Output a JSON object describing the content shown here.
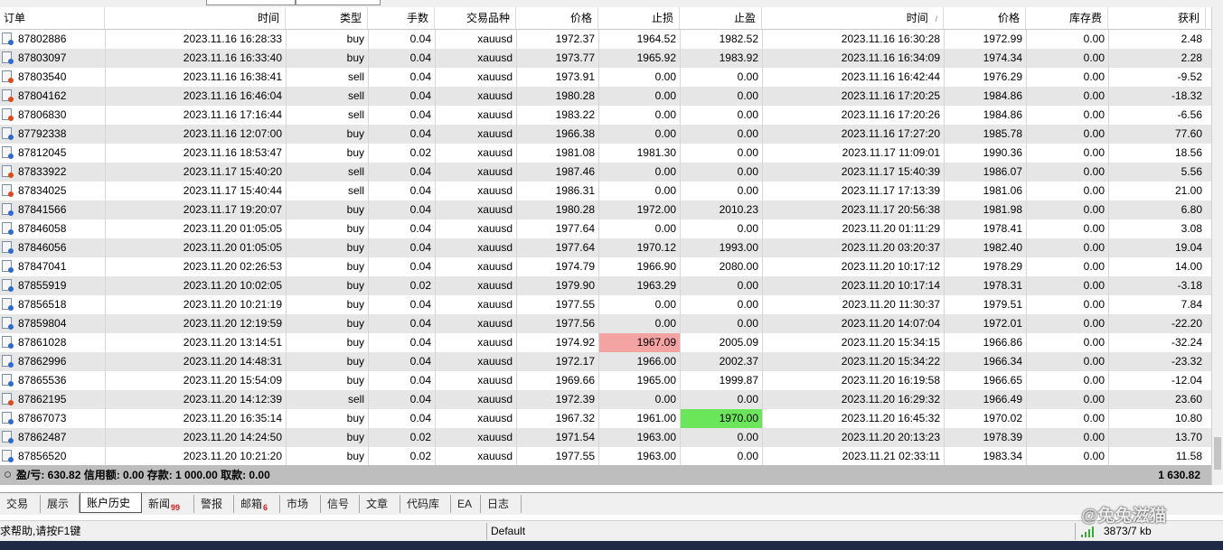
{
  "columns": [
    "订单",
    "时间",
    "类型",
    "手数",
    "交易品种",
    "价格",
    "止损",
    "止盈",
    "时间",
    "价格",
    "库存费",
    "获利"
  ],
  "rows": [
    {
      "order": "87802886",
      "open_time": "2023.11.16 16:28:33",
      "type": "buy",
      "lots": "0.04",
      "symbol": "xauusd",
      "open_price": "1972.37",
      "sl": "1964.52",
      "tp": "1982.52",
      "close_time": "2023.11.16 16:30:28",
      "close_price": "1972.99",
      "swap": "0.00",
      "profit": "2.48"
    },
    {
      "order": "87803097",
      "open_time": "2023.11.16 16:33:40",
      "type": "buy",
      "lots": "0.04",
      "symbol": "xauusd",
      "open_price": "1973.77",
      "sl": "1965.92",
      "tp": "1983.92",
      "close_time": "2023.11.16 16:34:09",
      "close_price": "1974.34",
      "swap": "0.00",
      "profit": "2.28"
    },
    {
      "order": "87803540",
      "open_time": "2023.11.16 16:38:41",
      "type": "sell",
      "lots": "0.04",
      "symbol": "xauusd",
      "open_price": "1973.91",
      "sl": "0.00",
      "tp": "0.00",
      "close_time": "2023.11.16 16:42:44",
      "close_price": "1976.29",
      "swap": "0.00",
      "profit": "-9.52"
    },
    {
      "order": "87804162",
      "open_time": "2023.11.16 16:46:04",
      "type": "sell",
      "lots": "0.04",
      "symbol": "xauusd",
      "open_price": "1980.28",
      "sl": "0.00",
      "tp": "0.00",
      "close_time": "2023.11.16 17:20:25",
      "close_price": "1984.86",
      "swap": "0.00",
      "profit": "-18.32"
    },
    {
      "order": "87806830",
      "open_time": "2023.11.16 17:16:44",
      "type": "sell",
      "lots": "0.04",
      "symbol": "xauusd",
      "open_price": "1983.22",
      "sl": "0.00",
      "tp": "0.00",
      "close_time": "2023.11.16 17:20:26",
      "close_price": "1984.86",
      "swap": "0.00",
      "profit": "-6.56"
    },
    {
      "order": "87792338",
      "open_time": "2023.11.16 12:07:00",
      "type": "buy",
      "lots": "0.04",
      "symbol": "xauusd",
      "open_price": "1966.38",
      "sl": "0.00",
      "tp": "0.00",
      "close_time": "2023.11.16 17:27:20",
      "close_price": "1985.78",
      "swap": "0.00",
      "profit": "77.60"
    },
    {
      "order": "87812045",
      "open_time": "2023.11.16 18:53:47",
      "type": "buy",
      "lots": "0.02",
      "symbol": "xauusd",
      "open_price": "1981.08",
      "sl": "1981.30",
      "tp": "0.00",
      "close_time": "2023.11.17 11:09:01",
      "close_price": "1990.36",
      "swap": "0.00",
      "profit": "18.56"
    },
    {
      "order": "87833922",
      "open_time": "2023.11.17 15:40:20",
      "type": "sell",
      "lots": "0.04",
      "symbol": "xauusd",
      "open_price": "1987.46",
      "sl": "0.00",
      "tp": "0.00",
      "close_time": "2023.11.17 15:40:39",
      "close_price": "1986.07",
      "swap": "0.00",
      "profit": "5.56"
    },
    {
      "order": "87834025",
      "open_time": "2023.11.17 15:40:44",
      "type": "sell",
      "lots": "0.04",
      "symbol": "xauusd",
      "open_price": "1986.31",
      "sl": "0.00",
      "tp": "0.00",
      "close_time": "2023.11.17 17:13:39",
      "close_price": "1981.06",
      "swap": "0.00",
      "profit": "21.00"
    },
    {
      "order": "87841566",
      "open_time": "2023.11.17 19:20:07",
      "type": "buy",
      "lots": "0.04",
      "symbol": "xauusd",
      "open_price": "1980.28",
      "sl": "1972.00",
      "tp": "2010.23",
      "close_time": "2023.11.17 20:56:38",
      "close_price": "1981.98",
      "swap": "0.00",
      "profit": "6.80"
    },
    {
      "order": "87846058",
      "open_time": "2023.11.20 01:05:05",
      "type": "buy",
      "lots": "0.04",
      "symbol": "xauusd",
      "open_price": "1977.64",
      "sl": "0.00",
      "tp": "0.00",
      "close_time": "2023.11.20 01:11:29",
      "close_price": "1978.41",
      "swap": "0.00",
      "profit": "3.08"
    },
    {
      "order": "87846056",
      "open_time": "2023.11.20 01:05:05",
      "type": "buy",
      "lots": "0.04",
      "symbol": "xauusd",
      "open_price": "1977.64",
      "sl": "1970.12",
      "tp": "1993.00",
      "close_time": "2023.11.20 03:20:37",
      "close_price": "1982.40",
      "swap": "0.00",
      "profit": "19.04"
    },
    {
      "order": "87847041",
      "open_time": "2023.11.20 02:26:53",
      "type": "buy",
      "lots": "0.04",
      "symbol": "xauusd",
      "open_price": "1974.79",
      "sl": "1966.90",
      "tp": "2080.00",
      "close_time": "2023.11.20 10:17:12",
      "close_price": "1978.29",
      "swap": "0.00",
      "profit": "14.00"
    },
    {
      "order": "87855919",
      "open_time": "2023.11.20 10:02:05",
      "type": "buy",
      "lots": "0.02",
      "symbol": "xauusd",
      "open_price": "1979.90",
      "sl": "1963.29",
      "tp": "0.00",
      "close_time": "2023.11.20 10:17:14",
      "close_price": "1978.31",
      "swap": "0.00",
      "profit": "-3.18"
    },
    {
      "order": "87856518",
      "open_time": "2023.11.20 10:21:19",
      "type": "buy",
      "lots": "0.04",
      "symbol": "xauusd",
      "open_price": "1977.55",
      "sl": "0.00",
      "tp": "0.00",
      "close_time": "2023.11.20 11:30:37",
      "close_price": "1979.51",
      "swap": "0.00",
      "profit": "7.84"
    },
    {
      "order": "87859804",
      "open_time": "2023.11.20 12:19:59",
      "type": "buy",
      "lots": "0.04",
      "symbol": "xauusd",
      "open_price": "1977.56",
      "sl": "0.00",
      "tp": "0.00",
      "close_time": "2023.11.20 14:07:04",
      "close_price": "1972.01",
      "swap": "0.00",
      "profit": "-22.20"
    },
    {
      "order": "87861028",
      "open_time": "2023.11.20 13:14:51",
      "type": "buy",
      "lots": "0.04",
      "symbol": "xauusd",
      "open_price": "1974.92",
      "sl": "1967.09",
      "tp": "2005.09",
      "close_time": "2023.11.20 15:34:15",
      "close_price": "1966.86",
      "swap": "0.00",
      "profit": "-32.24",
      "sl_hit": true
    },
    {
      "order": "87862996",
      "open_time": "2023.11.20 14:48:31",
      "type": "buy",
      "lots": "0.04",
      "symbol": "xauusd",
      "open_price": "1972.17",
      "sl": "1966.00",
      "tp": "2002.37",
      "close_time": "2023.11.20 15:34:22",
      "close_price": "1966.34",
      "swap": "0.00",
      "profit": "-23.32"
    },
    {
      "order": "87865536",
      "open_time": "2023.11.20 15:54:09",
      "type": "buy",
      "lots": "0.04",
      "symbol": "xauusd",
      "open_price": "1969.66",
      "sl": "1965.00",
      "tp": "1999.87",
      "close_time": "2023.11.20 16:19:58",
      "close_price": "1966.65",
      "swap": "0.00",
      "profit": "-12.04"
    },
    {
      "order": "87862195",
      "open_time": "2023.11.20 14:12:39",
      "type": "sell",
      "lots": "0.04",
      "symbol": "xauusd",
      "open_price": "1972.39",
      "sl": "0.00",
      "tp": "0.00",
      "close_time": "2023.11.20 16:29:32",
      "close_price": "1966.49",
      "swap": "0.00",
      "profit": "23.60"
    },
    {
      "order": "87867073",
      "open_time": "2023.11.20 16:35:14",
      "type": "buy",
      "lots": "0.04",
      "symbol": "xauusd",
      "open_price": "1967.32",
      "sl": "1961.00",
      "tp": "1970.00",
      "close_time": "2023.11.20 16:45:32",
      "close_price": "1970.02",
      "swap": "0.00",
      "profit": "10.80",
      "tp_hit": true
    },
    {
      "order": "87862487",
      "open_time": "2023.11.20 14:24:50",
      "type": "buy",
      "lots": "0.02",
      "symbol": "xauusd",
      "open_price": "1971.54",
      "sl": "1963.00",
      "tp": "0.00",
      "close_time": "2023.11.20 20:13:23",
      "close_price": "1978.39",
      "swap": "0.00",
      "profit": "13.70"
    },
    {
      "order": "87856520",
      "open_time": "2023.11.20 10:21:20",
      "type": "buy",
      "lots": "0.02",
      "symbol": "xauusd",
      "open_price": "1977.55",
      "sl": "1963.00",
      "tp": "0.00",
      "close_time": "2023.11.21 02:33:11",
      "close_price": "1983.34",
      "swap": "0.00",
      "profit": "11.58"
    }
  ],
  "summary": {
    "text": "盈/亏: 630.82  信用额: 0.00  存款: 1 000.00  取款: 0.00",
    "total_profit": "1 630.82"
  },
  "tabs": [
    {
      "label": "交易"
    },
    {
      "label": "展示"
    },
    {
      "label": "账户历史",
      "active": true
    },
    {
      "label": "新闻",
      "badge": "99"
    },
    {
      "label": "警报"
    },
    {
      "label": "邮箱",
      "badge": "6"
    },
    {
      "label": "市场"
    },
    {
      "label": "信号"
    },
    {
      "label": "文章"
    },
    {
      "label": "代码库"
    },
    {
      "label": "EA"
    },
    {
      "label": "日志"
    }
  ],
  "status": {
    "help": "求帮助,请按F1键",
    "profile": "Default",
    "connection": "3873/7 kb"
  },
  "watermark": "@兔兔滋猫",
  "colors": {
    "sl_highlight": "#f4a3a3",
    "tp_highlight": "#6be65a",
    "summary_bg": "#bebebe",
    "row_alt": "#e6e6e6"
  }
}
